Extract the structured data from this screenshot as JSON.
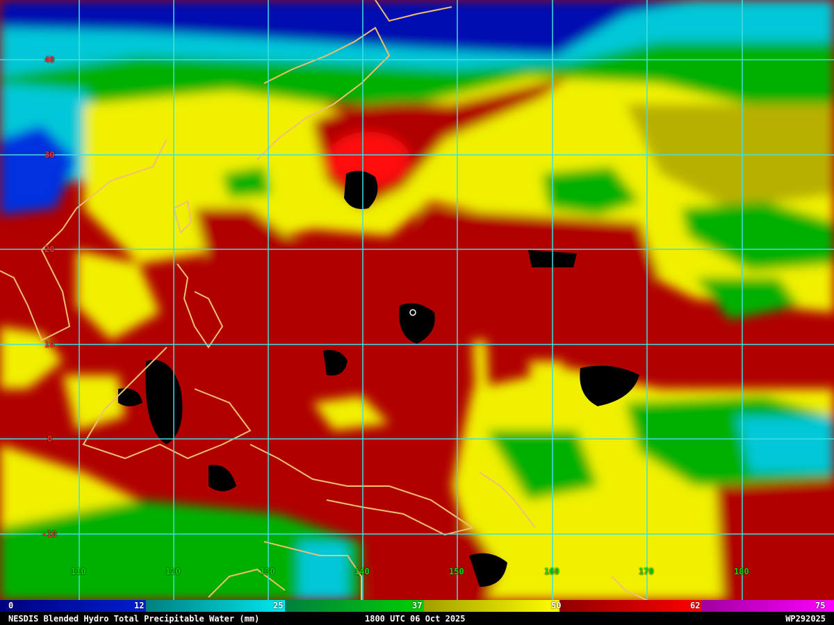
{
  "title": "NESDIS Blended Hydro Total Precipitable Water (mm)",
  "valid_time": "1800 UTC 06 Oct 2025",
  "storm_id": "WP292025",
  "latitude_labels": [
    "40",
    "30",
    "20",
    "10",
    "0",
    "-10"
  ],
  "longitude_labels": [
    "110",
    "120",
    "130",
    "140",
    "150",
    "160",
    "170",
    "180"
  ],
  "colorbar": {
    "ticks": [
      "0",
      "12",
      "25",
      "37",
      "50",
      "62",
      "75"
    ],
    "colors": {
      "dark_blue": "#0010b0",
      "blue": "#0030e0",
      "cyan": "#00c8d8",
      "teal": "#00a0a0",
      "green": "#00b000",
      "olive": "#b8b000",
      "yellow": "#f0f000",
      "dark_red": "#b00000",
      "red": "#ff1010",
      "magenta": "#d000d0"
    }
  },
  "grid_color": "#40e0e0",
  "coastline_color": "#f0c070",
  "storm_marker": "storm-center-circle"
}
